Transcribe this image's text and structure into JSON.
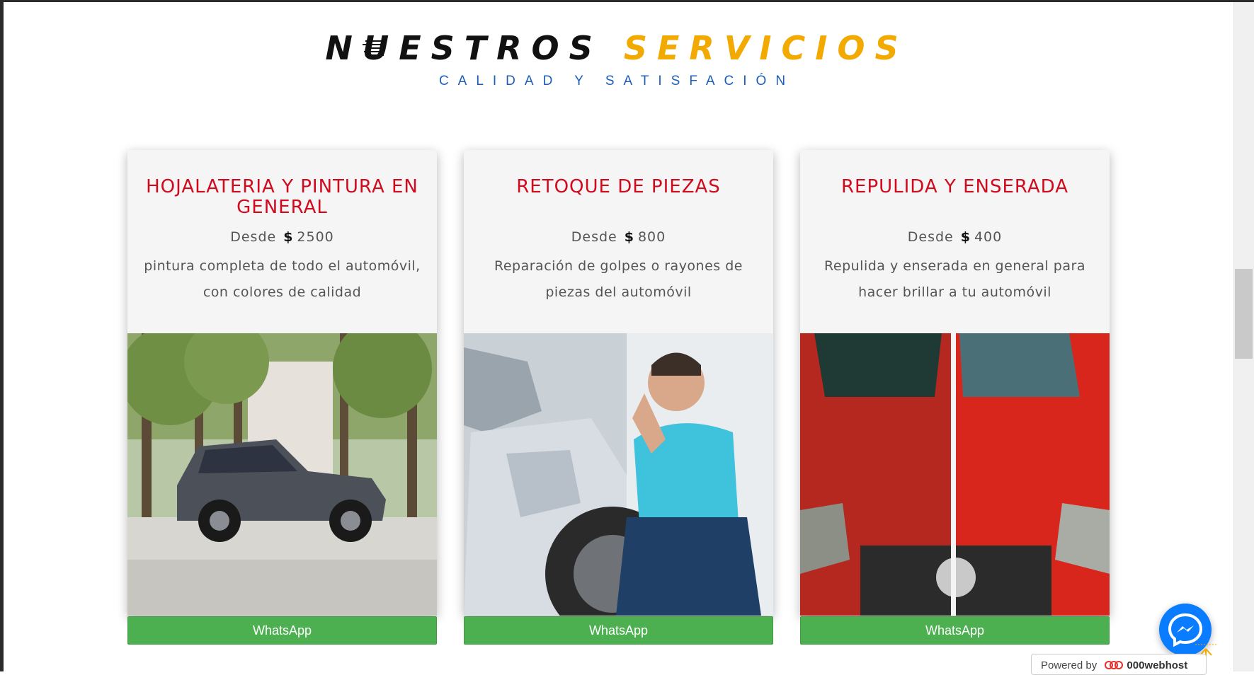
{
  "header": {
    "title_word1": "NUESTROS",
    "title_word2": "SERVICIOS",
    "subtitle": "CALIDAD Y SATISFACIÓN"
  },
  "colors": {
    "title_dark": "#111111",
    "title_accent": "#f2a900",
    "subtitle_blue": "#1d5fb8",
    "card_title_red": "#d20a1e",
    "whatsapp_green": "#4caf50",
    "messenger_blue": "#0a7cff"
  },
  "services": [
    {
      "title": "HOJALATERIA Y PINTURA EN GENERAL",
      "price_prefix": "Desde",
      "currency": "$",
      "price": "2500",
      "description": "pintura completa de todo el automóvil, con colores de calidad",
      "image": "gray-sedan-in-park",
      "button_label": "WhatsApp"
    },
    {
      "title": "RETOQUE DE PIEZAS",
      "price_prefix": "Desde",
      "currency": "$",
      "price": "800",
      "description": "Reparación de golpes o rayones de piezas del automóvil",
      "image": "man-with-dented-car",
      "button_label": "WhatsApp"
    },
    {
      "title": "REPULIDA Y ENSERADA",
      "price_prefix": "Desde",
      "currency": "$",
      "price": "400",
      "description": "Repulida y enserada en general para hacer brillar a tu automóvil",
      "image": "red-car-before-after-polish",
      "button_label": "WhatsApp"
    }
  ],
  "footer": {
    "powered_by": "Powered by",
    "host_name": "000webhost",
    "messenger_icon": "messenger-icon",
    "scroll_top_icon": "arrow-up-icon"
  }
}
